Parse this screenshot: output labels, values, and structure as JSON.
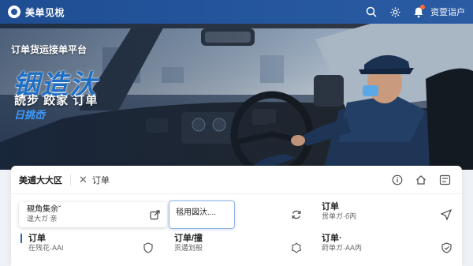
{
  "appbar": {
    "title": "美单见梲",
    "user_label": "资萱诣户",
    "icons": [
      "search-icon",
      "gear-icon",
      "bell-icon"
    ]
  },
  "hero": {
    "subtitle": "订单货运接单平台",
    "big_text": "铟造汏",
    "line2": "読步  跤家  订单",
    "line3": "日挑岙"
  },
  "panel": {
    "region": "美逋大大区",
    "crumb": "订单",
    "head_icons": [
      "info-icon",
      "home-icon",
      "layout-icon"
    ]
  },
  "items": [
    {
      "title": "覡角集余ˇ",
      "sub": "遑大ガ  亲"
    },
    {
      "title": "毯用図汏...."
    },
    {
      "title": "订单",
      "sub": "贯单ガ·б丙"
    },
    {
      "title": "订单",
      "sub": "在残花·AAI"
    },
    {
      "title": "订单/撞",
      "sub": "贡遘划般"
    },
    {
      "title": "订单·",
      "sub": "莳单ガ·AA丙"
    }
  ],
  "colors": {
    "brand": "#25579f",
    "accent": "#1e6fc4",
    "badge": "#ff6a3d"
  }
}
